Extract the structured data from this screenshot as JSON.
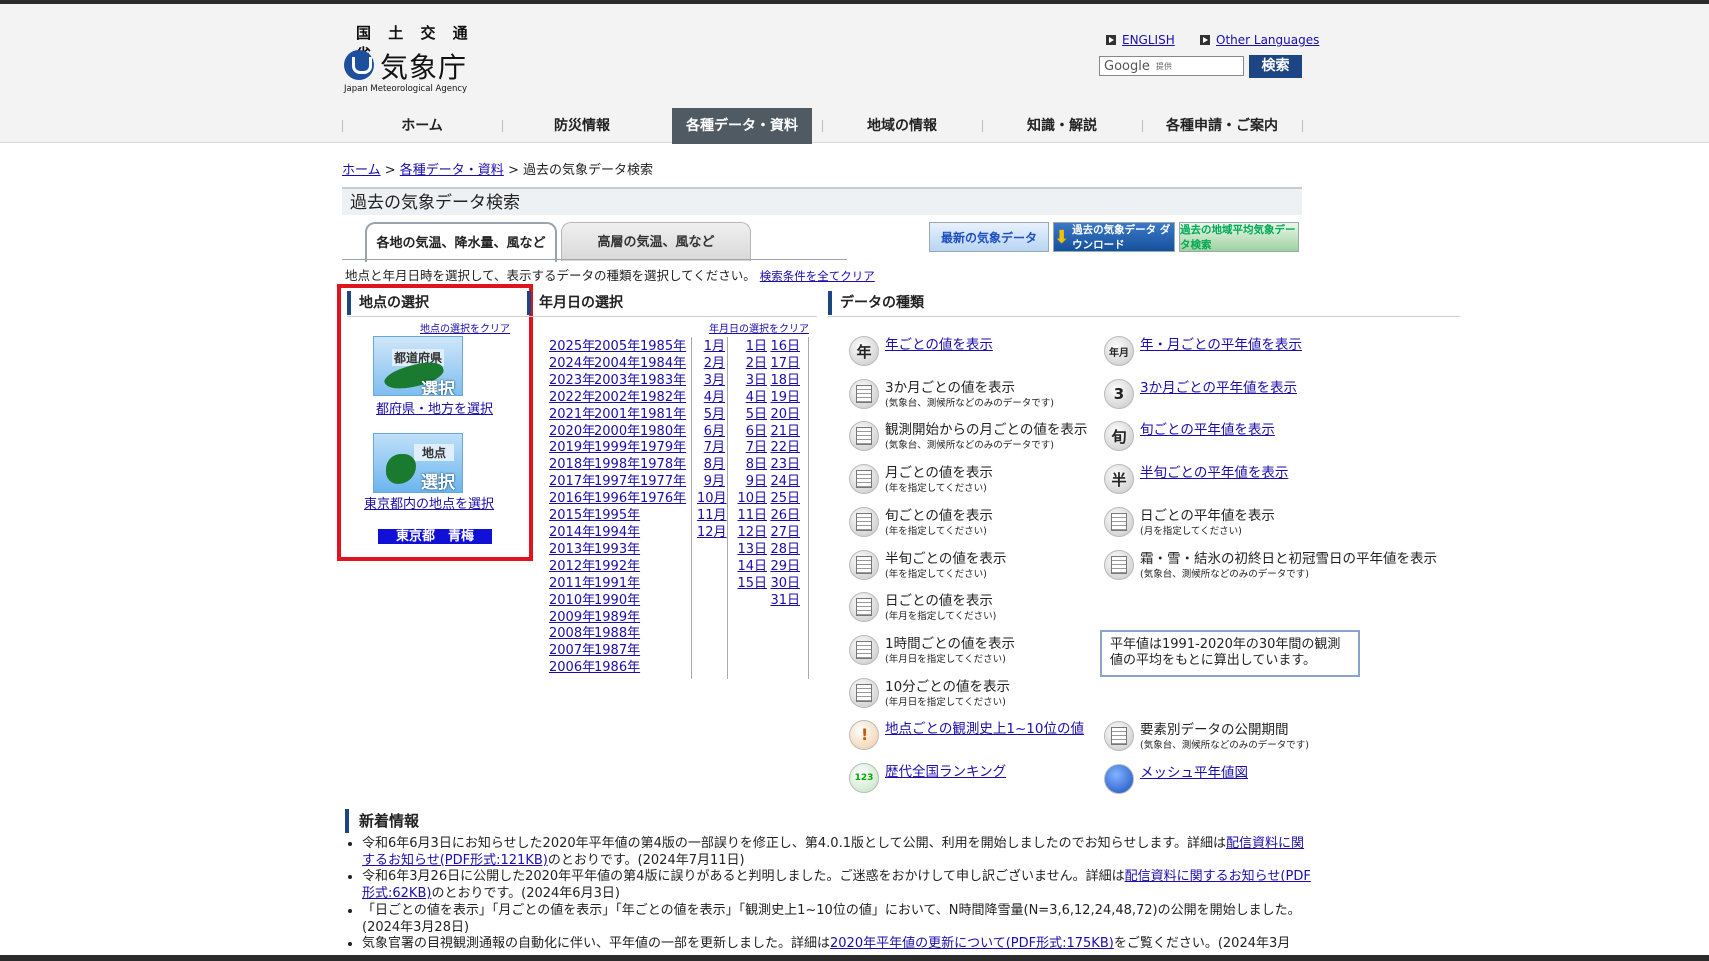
{
  "header": {
    "ministry": "国 土 交 通 省",
    "agency_jp": "気象庁",
    "agency_en": "Japan Meteorological Agency",
    "lang_english": "ENGLISH",
    "lang_other": "Other Languages",
    "search_google": "Google",
    "search_teikyo": "提供",
    "search_button": "検索"
  },
  "nav": [
    "ホーム",
    "防災情報",
    "各種データ・資料",
    "地域の情報",
    "知識・解説",
    "各種申請・ご案内"
  ],
  "breadcrumb": {
    "home": "ホーム",
    "data": "各種データ・資料",
    "sep": " > ",
    "current": "過去の気象データ検索"
  },
  "page_title": "過去の気象データ検索",
  "tabs": {
    "surface": "各地の気温、降水量、風など",
    "upper": "高層の気温、風など"
  },
  "banners": {
    "latest": "最新の気象データ",
    "download": "過去の気象データ ダウンロード",
    "area_avg": "過去の地域平均気象データ検索"
  },
  "instruction": "地点と年月日時を選択して、表示するデータの種類を選択してください。",
  "clear_all": "検索条件を全てクリア",
  "station": {
    "heading": "地点の選択",
    "clear": "地点の選択をクリア",
    "pref_caption_top": "都道府県",
    "pref_caption_bottom": "選択",
    "pref_link": "都府県・地方を選択",
    "point_caption_top": "地点",
    "point_caption_bottom": "選択",
    "point_link": "東京都内の地点を選択",
    "selected": "東京都　青梅"
  },
  "date": {
    "heading": "年月日の選択",
    "clear": "年月日の選択をクリア",
    "years_col1": [
      "2025年",
      "2024年",
      "2023年",
      "2022年",
      "2021年",
      "2020年",
      "2019年",
      "2018年",
      "2017年",
      "2016年",
      "2015年",
      "2014年",
      "2013年",
      "2012年",
      "2011年",
      "2010年",
      "2009年",
      "2008年",
      "2007年",
      "2006年"
    ],
    "years_col2": [
      "2005年",
      "2004年",
      "2003年",
      "2002年",
      "2001年",
      "2000年",
      "1999年",
      "1998年",
      "1997年",
      "1996年",
      "1995年",
      "1994年",
      "1993年",
      "1992年",
      "1991年",
      "1990年",
      "1989年",
      "1988年",
      "1987年",
      "1986年"
    ],
    "years_col3": [
      "1985年",
      "1984年",
      "1983年",
      "1982年",
      "1981年",
      "1980年",
      "1979年",
      "1978年",
      "1977年",
      "1976年"
    ],
    "months": [
      "1月",
      "2月",
      "3月",
      "4月",
      "5月",
      "6月",
      "7月",
      "8月",
      "9月",
      "10月",
      "11月",
      "12月"
    ],
    "days_col1": [
      "1日",
      "2日",
      "3日",
      "4日",
      "5日",
      "6日",
      "7日",
      "8日",
      "9日",
      "10日",
      "11日",
      "12日",
      "13日",
      "14日",
      "15日"
    ],
    "days_col2": [
      "16日",
      "17日",
      "18日",
      "19日",
      "20日",
      "21日",
      "22日",
      "23日",
      "24日",
      "25日",
      "26日",
      "27日",
      "28日",
      "29日",
      "30日",
      "31日"
    ]
  },
  "datatype": {
    "heading": "データの種類",
    "left": [
      {
        "icon": "nen-icon",
        "glyph": "年",
        "label": "年ごとの値を表示",
        "sub": "",
        "link": true
      },
      {
        "icon": "table-icon",
        "glyph": "",
        "label": "3か月ごとの値を表示",
        "sub": "(気象台、測候所などのみのデータです)",
        "link": false
      },
      {
        "icon": "table-icon",
        "glyph": "",
        "label": "観測開始からの月ごとの値を表示",
        "sub": "(気象台、測候所などのみのデータです)",
        "link": false
      },
      {
        "icon": "table-icon",
        "glyph": "",
        "label": "月ごとの値を表示",
        "sub": "(年を指定してください)",
        "link": false
      },
      {
        "icon": "table-icon",
        "glyph": "",
        "label": "旬ごとの値を表示",
        "sub": "(年を指定してください)",
        "link": false
      },
      {
        "icon": "table-icon",
        "glyph": "",
        "label": "半旬ごとの値を表示",
        "sub": "(年を指定してください)",
        "link": false
      },
      {
        "icon": "table-icon",
        "glyph": "",
        "label": "日ごとの値を表示",
        "sub": "(年月を指定してください)",
        "link": false
      },
      {
        "icon": "table-icon",
        "glyph": "",
        "label": "1時間ごとの値を表示",
        "sub": "(年月日を指定してください)",
        "link": false
      },
      {
        "icon": "table-icon",
        "glyph": "",
        "label": "10分ごとの値を表示",
        "sub": "(年月日を指定してください)",
        "link": false
      },
      {
        "icon": "warning-icon",
        "glyph": "",
        "label": "地点ごとの観測史上1~10位の値",
        "sub": "",
        "link": true
      },
      {
        "icon": "ranking-icon",
        "glyph": "123",
        "label": "歴代全国ランキング",
        "sub": "",
        "link": true
      }
    ],
    "right": [
      {
        "icon": "nengetsu-icon",
        "glyph": "年月",
        "label": "年・月ごとの平年値を表示",
        "sub": "",
        "link": true
      },
      {
        "icon": "3month-icon",
        "glyph": "3",
        "label": "3か月ごとの平年値を表示",
        "sub": "",
        "link": true
      },
      {
        "icon": "jun-icon",
        "glyph": "旬",
        "label": "旬ごとの平年値を表示",
        "sub": "",
        "link": true
      },
      {
        "icon": "hanjun-icon",
        "glyph": "半",
        "label": "半旬ごとの平年値を表示",
        "sub": "",
        "link": true
      },
      {
        "icon": "table-icon",
        "glyph": "",
        "label": "日ごとの平年値を表示",
        "sub": "(月を指定してください)",
        "link": false
      },
      {
        "icon": "table-icon",
        "glyph": "",
        "label": "霜・雪・結氷の初終日と初冠雪日の平年値を表示",
        "sub": "(気象台、測候所などのみのデータです)",
        "link": false
      }
    ],
    "right_bottom": [
      {
        "icon": "table-icon",
        "glyph": "",
        "label": "要素別データの公開期間",
        "sub": "(気象台、測候所などのみのデータです)",
        "link": false
      },
      {
        "icon": "mesh-map-icon",
        "glyph": "",
        "label": "メッシュ平年値図",
        "sub": "",
        "link": true
      }
    ],
    "note": "平年値は1991-2020年の30年間の観測値の平均をもとに算出しています。"
  },
  "news": {
    "heading": "新着情報",
    "items": [
      {
        "pre": "令和6年6月3日にお知らせした2020年平年値の第4版の一部誤りを修正し、第4.0.1版として公開、利用を開始しましたのでお知らせします。詳細は",
        "link": "配信資料に関するお知らせ(PDF形式:121KB)",
        "post": "のとおりです。(2024年7月11日)"
      },
      {
        "pre": "令和6年3月26日に公開した2020年平年値の第4版に誤りがあると判明しました。ご迷惑をおかけして申し訳ございません。詳細は",
        "link": "配信資料に関するお知らせ(PDF形式:62KB)",
        "post": "のとおりです。(2024年6月3日)"
      },
      {
        "pre": "「日ごとの値を表示」「月ごとの値を表示」「年ごとの値を表示」「観測史上1~10位の値」において、N時間降雪量(N=3,6,12,24,48,72)の公開を開始しました。(2024年3月28日)",
        "link": "",
        "post": ""
      },
      {
        "pre": "気象官署の目視観測通報の自動化に伴い、平年値の一部を更新しました。詳細は",
        "link": "2020年平年値の更新について(PDF形式:175KB)",
        "post": "をご覧ください。(2024年3月"
      }
    ]
  }
}
